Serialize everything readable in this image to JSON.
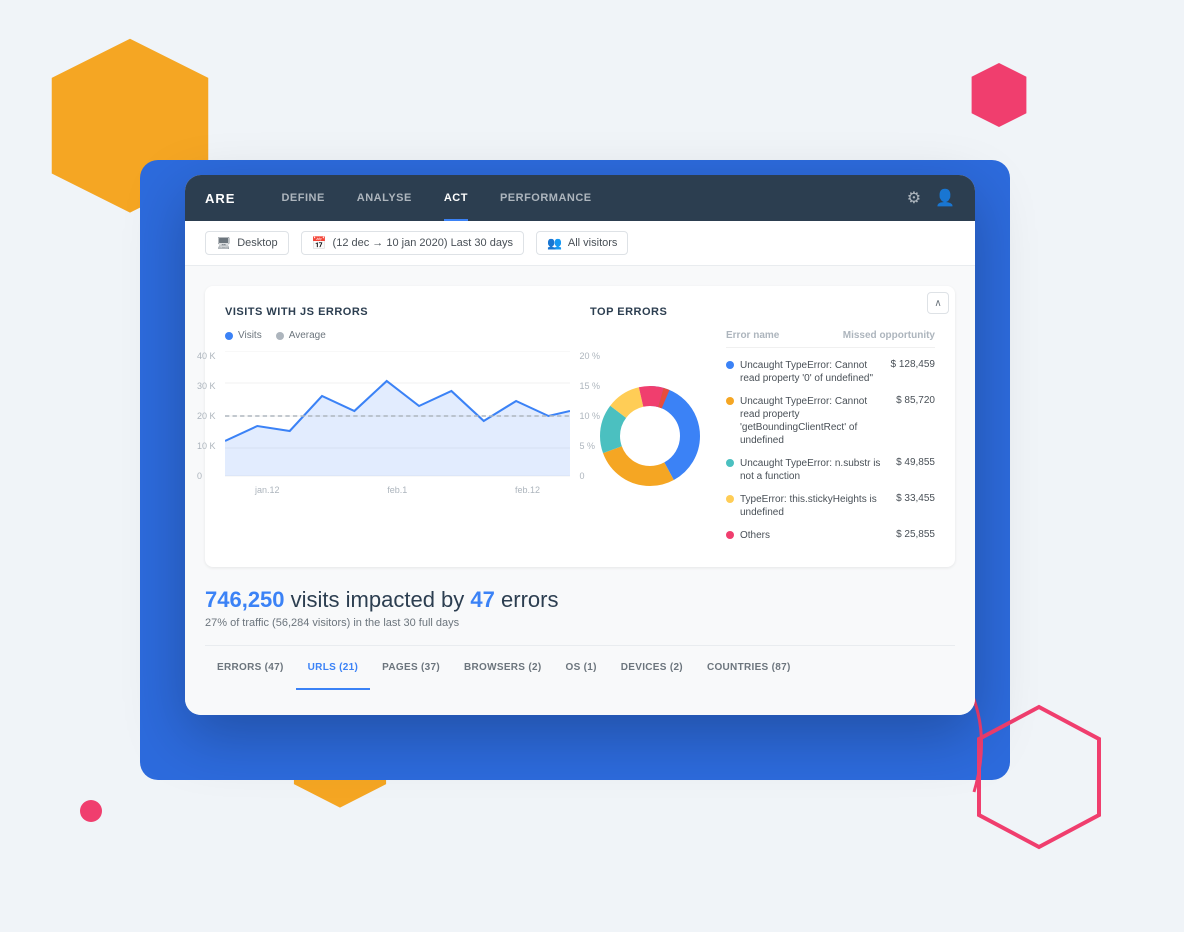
{
  "background": {
    "blue_rect": true,
    "hex_yellow_large": "#F5A623",
    "hex_yellow_small": "#F5A623",
    "hex_pink": "#f03e6e",
    "dot_pink": "#f03e6e"
  },
  "nav": {
    "brand": "ARE",
    "items": [
      {
        "label": "DEFINE",
        "active": false
      },
      {
        "label": "ANALYSE",
        "active": false
      },
      {
        "label": "ACT",
        "active": true
      },
      {
        "label": "PERFORMANCE",
        "active": false
      }
    ],
    "settings_icon": "⚙",
    "user_icon": "👤"
  },
  "filters": {
    "device": "Desktop",
    "date_range": "(12 dec → 10 jan 2020) Last 30 days",
    "visitors": "All visitors"
  },
  "chart_visits": {
    "title": "VISITS WITH JS ERRORS",
    "legend": [
      {
        "label": "Visits",
        "color": "#3b82f6"
      },
      {
        "label": "Average",
        "color": "#adb5bd"
      }
    ],
    "y_labels_left": [
      "40 K",
      "30 K",
      "20 K",
      "10 K",
      "0"
    ],
    "y_labels_right": [
      "20 %",
      "15 %",
      "10 %",
      "5 %",
      "0"
    ],
    "x_labels": [
      "jan.12",
      "feb.1",
      "feb.12"
    ]
  },
  "chart_top_errors": {
    "title": "TOP ERRORS",
    "col_error": "Error name",
    "col_missed": "Missed opportunity",
    "errors": [
      {
        "color": "#3b82f6",
        "name": "Uncaught TypeError: Cannot read property '0' of undefined\"",
        "value": "$ 128,459"
      },
      {
        "color": "#f5a623",
        "name": "Uncaught TypeError: Cannot read property 'getBoundingClientRect' of undefined",
        "value": "$ 85,720"
      },
      {
        "color": "#4bc0c0",
        "name": "Uncaught TypeError: n.substr is not a function",
        "value": "$ 49,855"
      },
      {
        "color": "#ffcd56",
        "name": "TypeError: this.stickyHeights is undefined",
        "value": "$ 33,455"
      },
      {
        "color": "#f03e6e",
        "name": "Others",
        "value": "$ 25,855"
      }
    ],
    "donut_colors": [
      "#3b82f6",
      "#f5a623",
      "#4bc0c0",
      "#ffcd56",
      "#f03e6e"
    ]
  },
  "summary": {
    "visits_count": "746,250",
    "text_middle": "visits impacted by",
    "errors_count": "47",
    "text_end": "errors",
    "sub_text": "27% of traffic (56,284 visitors) in the last 30 full days"
  },
  "tabs": [
    {
      "label": "ERRORS (47)",
      "active": false
    },
    {
      "label": "URLS (21)",
      "active": true
    },
    {
      "label": "PAGES (37)",
      "active": false
    },
    {
      "label": "BROWSERS (2)",
      "active": false
    },
    {
      "label": "OS (1)",
      "active": false
    },
    {
      "label": "DEVICES (2)",
      "active": false
    },
    {
      "label": "COUNTRIES (87)",
      "active": false
    }
  ]
}
